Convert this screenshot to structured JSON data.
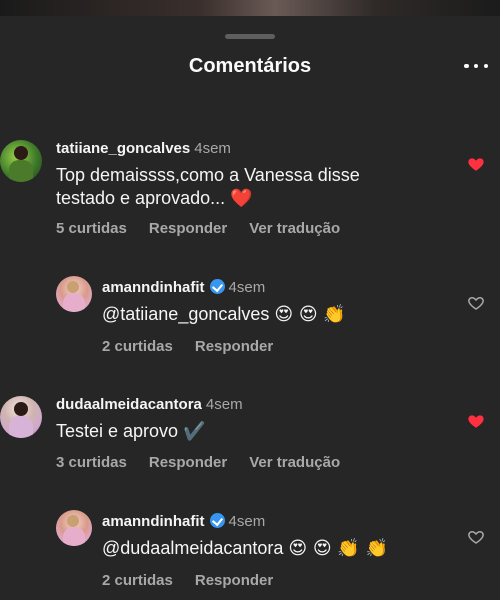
{
  "header": {
    "title": "Comentários"
  },
  "comments": [
    {
      "username": "tatiiane_goncalves",
      "time": "4sem",
      "text_line1": "Top demaissss,como a Vanessa disse",
      "text_line2": "testado e aprovado...",
      "text_emoji": "❤️",
      "likes": "5 curtidas",
      "reply": "Responder",
      "translate": "Ver tradução",
      "liked": true
    },
    {
      "username": "amanndinhafit",
      "time": "4sem",
      "text": "@tatiiane_goncalves",
      "emojis": "😍 😍 👏",
      "likes": "2 curtidas",
      "reply": "Responder",
      "liked": false
    },
    {
      "username": "dudaalmeidacantora",
      "time": "4sem",
      "text": "Testei e aprovo",
      "text_emoji": "✔️",
      "likes": "3 curtidas",
      "reply": "Responder",
      "translate": "Ver tradução",
      "liked": true
    },
    {
      "username": "amanndinhafit",
      "time": "4sem",
      "text": "@dudaalmeidacantora",
      "emojis": "😍 😍 👏 👏",
      "likes": "2 curtidas",
      "reply": "Responder",
      "liked": false
    }
  ],
  "colors": {
    "background": "#262626",
    "liked_heart": "#ff3040",
    "verified": "#3797f0",
    "muted": "#a8a8a8"
  }
}
